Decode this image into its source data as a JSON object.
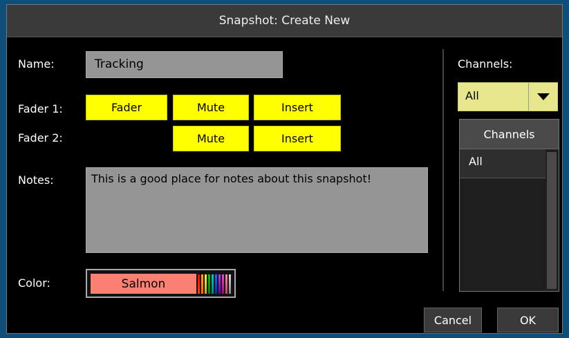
{
  "dialog": {
    "title": "Snapshot: Create New"
  },
  "name": {
    "label": "Name:",
    "value": "Tracking"
  },
  "fader1": {
    "label": "Fader 1:",
    "fader_label": "Fader",
    "mute_label": "Mute",
    "insert_label": "Insert"
  },
  "fader2": {
    "label": "Fader 2:",
    "mute_label": "Mute",
    "insert_label": "Insert"
  },
  "notes": {
    "label": "Notes:",
    "value": "This is a good place for notes about this snapshot!"
  },
  "color": {
    "label": "Color:",
    "value": "Salmon",
    "swatch_color": "#fa8072"
  },
  "channels": {
    "label": "Channels:",
    "selected": "All",
    "list_header": "Channels",
    "items": [
      "All"
    ]
  },
  "buttons": {
    "cancel": "Cancel",
    "ok": "OK"
  },
  "colors": {
    "accent_yellow": "#ffff00",
    "dropdown_bg": "#e6e68c",
    "field_gray": "#959595"
  }
}
